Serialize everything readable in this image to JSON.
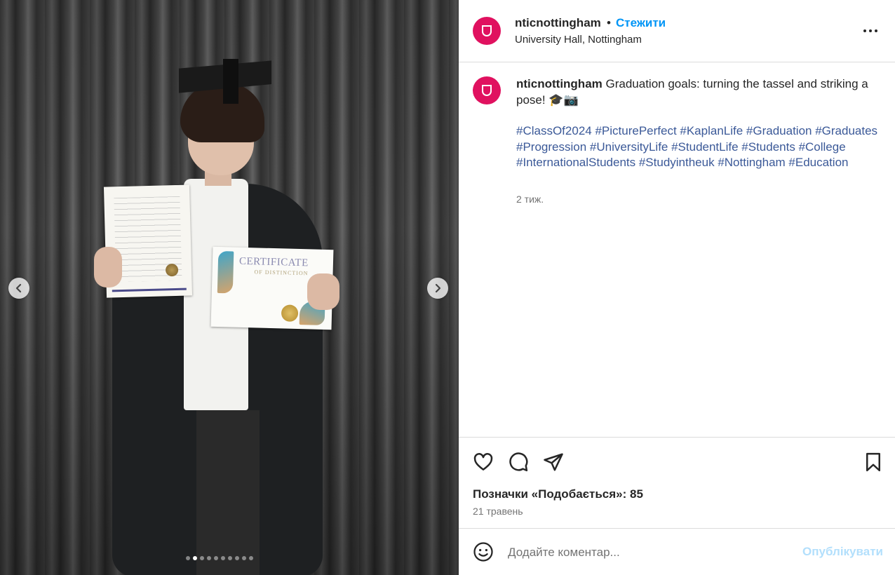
{
  "header": {
    "username": "nticnottingham",
    "separator": "•",
    "follow_label": "Стежити",
    "location": "University Hall, Nottingham",
    "avatar_icon": "university-shield-icon",
    "brand_color": "#e0115f"
  },
  "media": {
    "slide_count": 10,
    "active_slide": 2,
    "certificate_title": "CERTIFICATE",
    "certificate_subtitle": "OF DISTINCTION",
    "prev_icon": "chevron-left-icon",
    "next_icon": "chevron-right-icon"
  },
  "caption": {
    "username": "nticnottingham",
    "text": " Graduation goals: turning the tassel and striking a pose! 🎓📷",
    "hashtags": "#ClassOf2024 #PicturePerfect #KaplanLife #Graduation #Graduates #Progression #UniversityLife #StudentLife #Students #College #InternationalStudents #Studyintheuk #Nottingham #Education",
    "time_ago": "2 тиж."
  },
  "actions": {
    "like_icon": "heart-icon",
    "comment_icon": "comment-bubble-icon",
    "share_icon": "send-icon",
    "save_icon": "bookmark-icon",
    "likes_text": "Позначки «Подобається»: 85",
    "date": "21 травень"
  },
  "comment": {
    "emoji_icon": "smiley-icon",
    "placeholder": "Додайте коментар...",
    "publish_label": "Опублікувати",
    "publish_color": "#b2dffc"
  }
}
